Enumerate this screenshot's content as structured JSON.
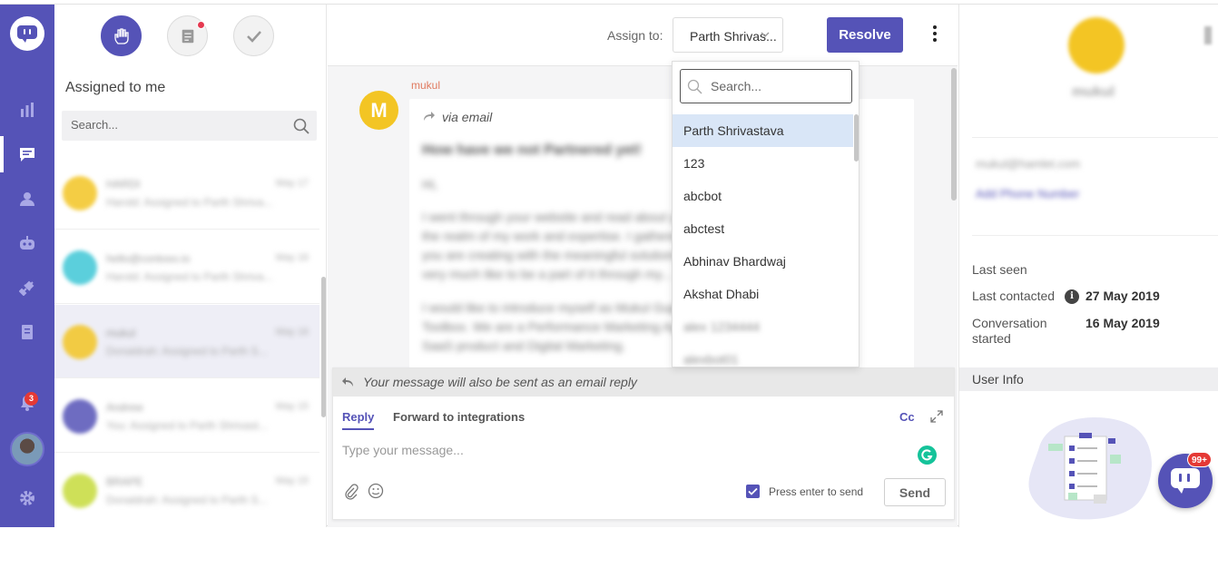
{
  "rail": {
    "notification_count": "3",
    "items": [
      {
        "icon": "reports-icon"
      },
      {
        "icon": "conversations-icon"
      },
      {
        "icon": "contacts-icon"
      },
      {
        "icon": "bot-icon"
      },
      {
        "icon": "integrations-icon"
      },
      {
        "icon": "knowledge-base-icon"
      },
      {
        "icon": "notifications-icon"
      },
      {
        "icon": "settings-icon"
      }
    ]
  },
  "list": {
    "title": "Assigned to me",
    "search_placeholder": "Search...",
    "filters": [
      "hand-icon",
      "notes-icon",
      "check-icon"
    ]
  },
  "conversations": [
    {
      "name": "HARDI",
      "time": "May 17",
      "preview": "Harold: Assigned to Parth Shriva...",
      "color": "#f3c524"
    },
    {
      "name": "hello@contoso.io",
      "time": "May 16",
      "preview": "Harold: Assigned to Parth Shriva...",
      "color": "#3fc7d6"
    },
    {
      "name": "mukul",
      "time": "May 16",
      "preview": "Donaldrah: Assigned to Parth S...",
      "color": "#f3c524"
    },
    {
      "name": "Andrew",
      "time": "May 15",
      "preview": "You: Assigned to Parth Shrivast...",
      "color": "#5553b7"
    },
    {
      "name": "BRAPE",
      "time": "May 15",
      "preview": "Donaldrah: Assigned to Parth S...",
      "color": "#c6db3c"
    }
  ],
  "header": {
    "assign_label": "Assign to:",
    "assignee": "Parth Shrivas...",
    "resolve_label": "Resolve"
  },
  "message": {
    "avatar_letter": "M",
    "author": "mukul",
    "via": "via email",
    "subject": "How have we not Partnered yet!",
    "greeting": "Hi,",
    "p1_l1": "I went through your website and read about your services and caught",
    "p1_l2": "the realm of my work and expertise. I gathered that the sort of businesses",
    "p1_l3": "you are creating with the meaningful solutions that. I'd really love to be",
    "p1_l4": "very much like to be a part of it through my...",
    "p2_l1": "I would like to introduce myself as Mukul Gupta, a Growth Expert for",
    "p2_l2": "Toolbox. We are a Performance Marketing Agency. We have helped about",
    "p2_l3": "SaaS product and Digital Marketing."
  },
  "composer": {
    "email_note": "Your message will also be sent as an email reply",
    "tab_reply": "Reply",
    "tab_forward": "Forward to integrations",
    "cc": "Cc",
    "placeholder": "Type your message...",
    "press_enter": "Press enter to send",
    "send": "Send"
  },
  "dropdown": {
    "search_placeholder": "Search...",
    "options": [
      "Parth Shrivastava",
      "123",
      "abcbot",
      "abctest",
      "Abhinav Bhardwaj",
      "Akshat Dhabi",
      "alex 1234444",
      "alexbot01"
    ]
  },
  "profile": {
    "avatar_letter": "M",
    "name": "mukul",
    "email": "mukul@hamlet.com",
    "phone": "Add Phone Number",
    "last_seen_label": "Last seen",
    "last_seen_value": "",
    "last_contacted_label": "Last contacted",
    "last_contacted_value": "27 May 2019",
    "conv_started_label_1": "Conversation",
    "conv_started_label_2": "started",
    "conv_started_value": "16 May 2019",
    "user_info": "User Info"
  },
  "fab": {
    "badge": "99+"
  },
  "colors": {
    "accent": "#5553b7",
    "avatar_yellow": "#f3c524",
    "badge_red": "#e53935",
    "selected_row": "#d9e6f7"
  }
}
